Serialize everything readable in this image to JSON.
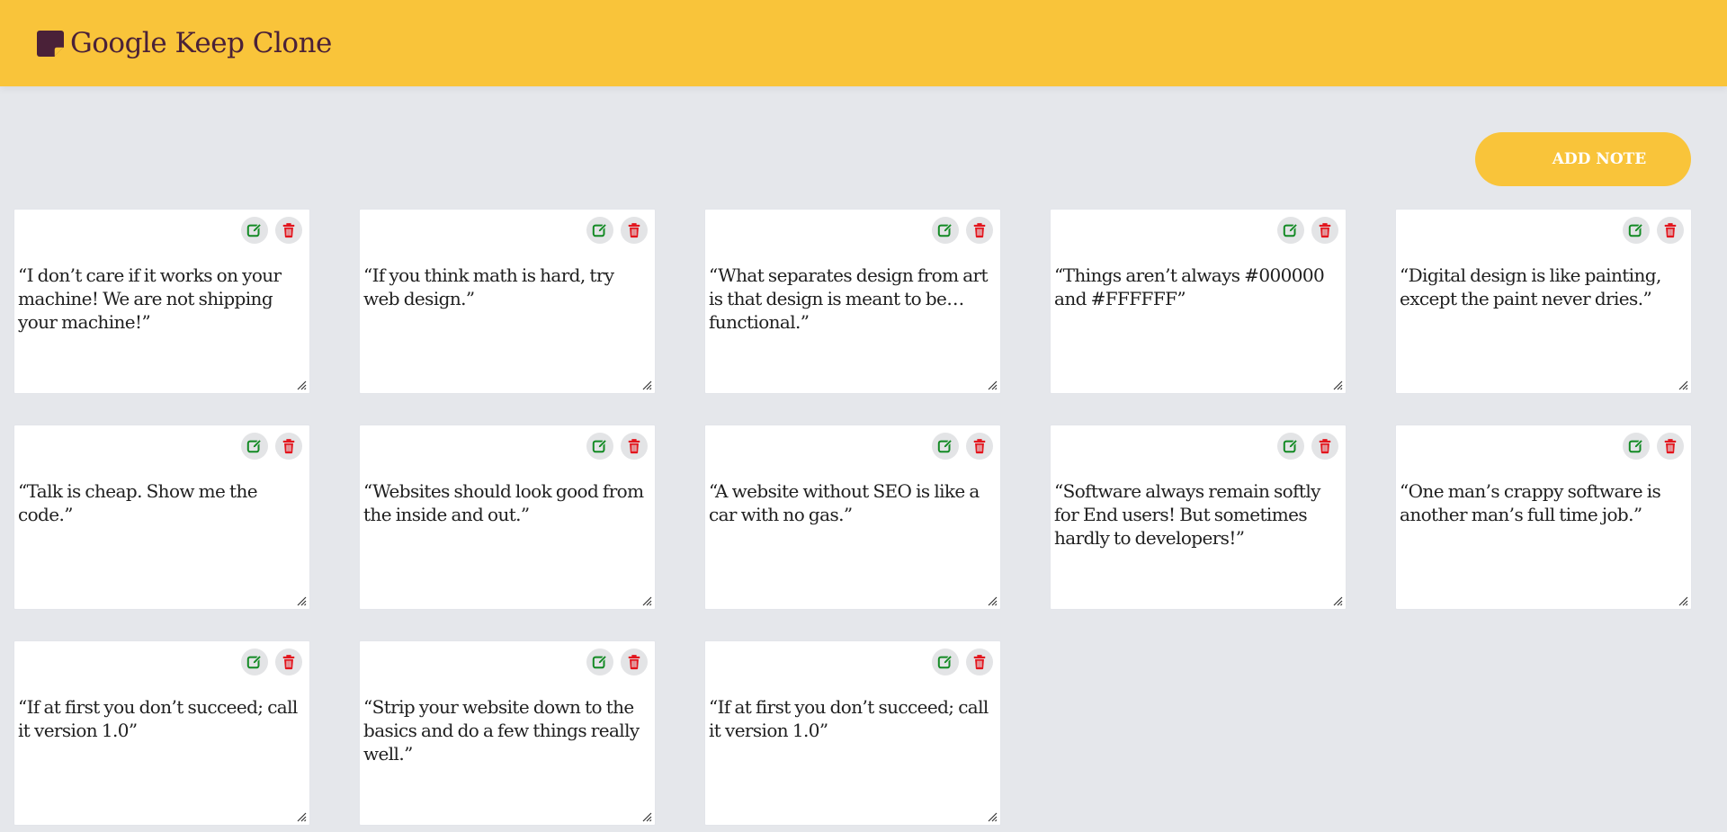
{
  "app": {
    "title": "Google Keep Clone",
    "logo_icon": "sticky-note-icon"
  },
  "toolbar": {
    "add_note_label": "ADD NOTE"
  },
  "colors": {
    "header": "#f9c43a",
    "title": "#4a2138",
    "edit": "#138a24",
    "delete": "#e3151d",
    "background": "#e5e7eb"
  },
  "notes": [
    {
      "text": "“I don’t care if it works on your machine! We are not shipping your machine!”"
    },
    {
      "text": "“If you think math is hard, try web design.”"
    },
    {
      "text": "“What separates design from art is that design is meant to be… functional.”"
    },
    {
      "text": "“Things aren’t always #000000 and #FFFFFF”"
    },
    {
      "text": "“Digital design is like painting, except the paint never dries.”"
    },
    {
      "text": "“Talk is cheap. Show me the code.”"
    },
    {
      "text": "“Websites should look good from the inside and out.”"
    },
    {
      "text": "“A website without SEO is like a car with no gas.”"
    },
    {
      "text": "“Software always remain softly for End users! But sometimes hardly to developers!”"
    },
    {
      "text": "“One man’s crappy software is another man’s full time job.”"
    },
    {
      "text": "“If at first you don’t succeed; call it version 1.0”"
    },
    {
      "text": "“Strip your website down to the basics and do a few things really well.”"
    },
    {
      "text": "“If at first you don’t succeed; call it version 1.0”"
    }
  ]
}
